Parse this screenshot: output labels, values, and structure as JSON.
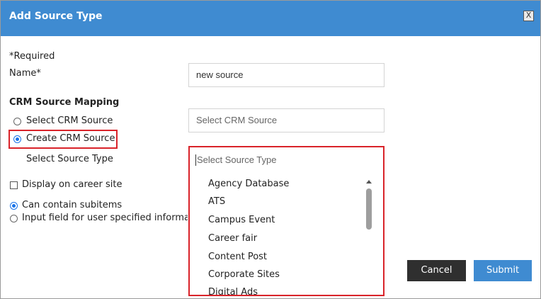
{
  "dialog": {
    "title": "Add Source Type",
    "close_label": "X"
  },
  "form": {
    "required_note": "*Required",
    "name_label": "Name*",
    "name_value": "new source",
    "crm_heading": "CRM Source Mapping",
    "option_select_crm": "Select CRM Source",
    "option_create_crm": "Create CRM Source",
    "crm_source_placeholder": "Select CRM Source",
    "source_type_label": "Select Source Type",
    "display_career_site": "Display on career site",
    "can_contain_subitems": "Can contain subitems",
    "input_field_user": "Input field for user specified informat"
  },
  "dropdown": {
    "placeholder": "Select Source Type",
    "items": [
      "Agency Database",
      "ATS",
      "Campus Event",
      "Career fair",
      "Content Post",
      "Corporate Sites",
      "Digital Ads"
    ]
  },
  "buttons": {
    "cancel": "Cancel",
    "submit": "Submit"
  },
  "colors": {
    "titlebar": "#3f8bd1",
    "highlight": "#d9232a",
    "cancel_bg": "#2f2f2f",
    "submit_bg": "#3f8bd1",
    "radio_checked": "#1a73e8"
  }
}
